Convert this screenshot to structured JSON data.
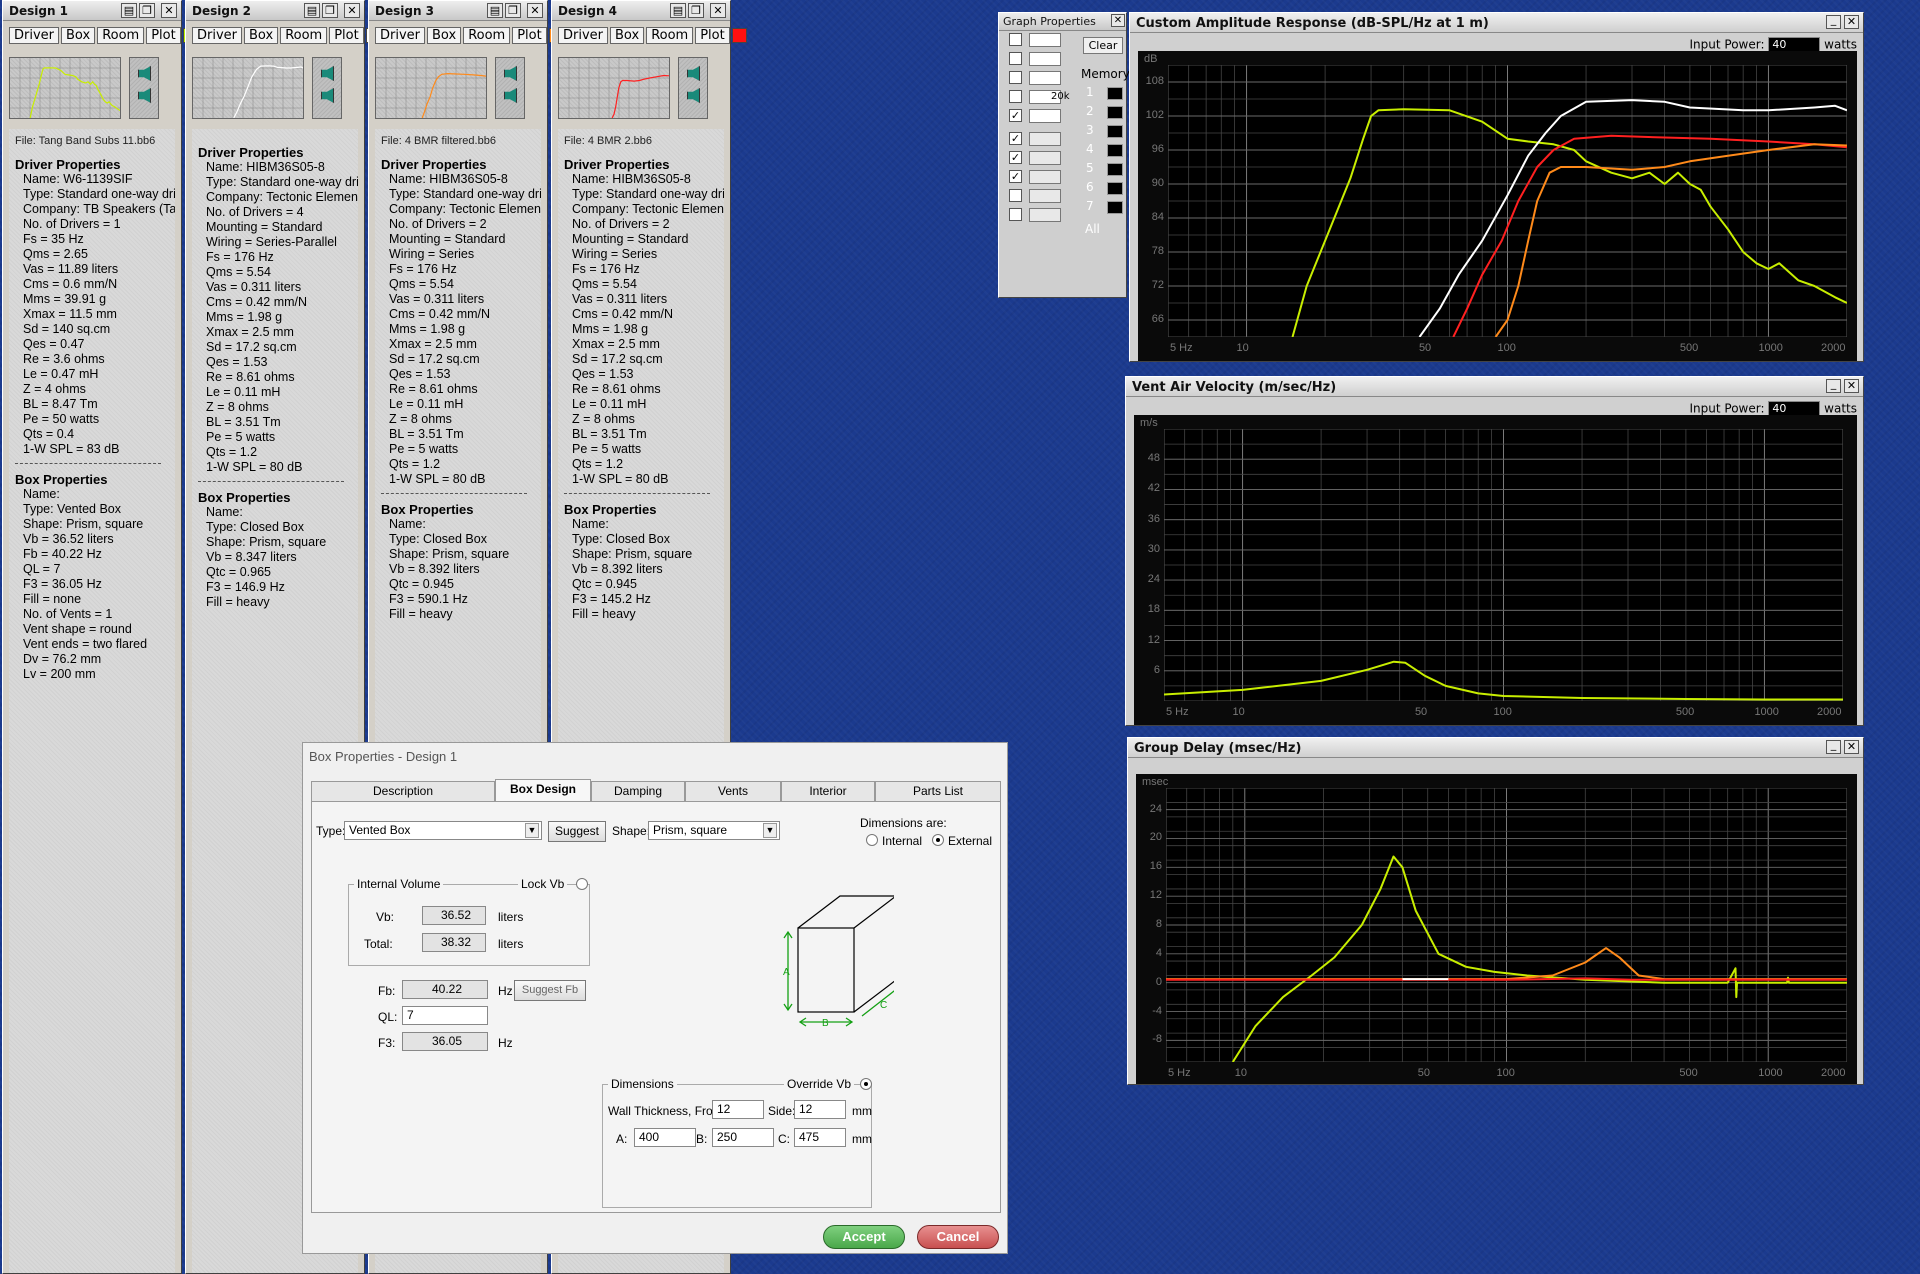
{
  "designs": [
    {
      "title": "Design 1",
      "tabs": [
        "Driver",
        "Box",
        "Room",
        "Plot"
      ],
      "swatch": "#b8f000",
      "color": "#c8ee00",
      "file": "File: Tang Band Subs 11.bb6",
      "driver_header": "Driver Properties",
      "driver": [
        "Name: W6-1139SIF",
        "Type: Standard one-way driver",
        "Company: TB Speakers  (Tang Band)",
        "No. of Drivers = 1",
        "Fs = 35 Hz",
        "Qms = 2.65",
        "Vas = 11.89 liters",
        "Cms = 0.6 mm/N",
        "Mms = 39.91 g",
        "Xmax = 11.5 mm",
        "Sd = 140 sq.cm",
        "Qes = 0.47",
        "Re = 3.6 ohms",
        "Le = 0.47 mH",
        "Z = 4 ohms",
        "BL = 8.47 Tm",
        "Pe = 50 watts",
        "Qts = 0.4",
        "1-W SPL = 83 dB"
      ],
      "box_header": "Box Properties",
      "box": [
        "Name:",
        "Type: Vented Box",
        "Shape: Prism, square",
        "Vb = 36.52 liters",
        "Fb = 40.22 Hz",
        "QL = 7",
        "F3 = 36.05 Hz",
        "Fill = none",
        "No. of Vents = 1",
        "Vent shape = round",
        "Vent ends = two flared",
        "Dv = 76.2 mm",
        "Lv = 200 mm"
      ]
    },
    {
      "title": "Design 2",
      "tabs": [
        "Driver",
        "Box",
        "Room",
        "Plot"
      ],
      "swatch": "#ffffff",
      "color": "#ffffff",
      "file": "",
      "driver_header": "Driver Properties",
      "driver": [
        "Name: HIBM36S05-8",
        "Type: Standard one-way driver",
        "Company: Tectonic Elements",
        "No. of Drivers = 4",
        "Mounting = Standard",
        "Wiring = Series-Parallel",
        "Fs = 176 Hz",
        "Qms = 5.54",
        "Vas = 0.311 liters",
        "Cms = 0.42 mm/N",
        "Mms = 1.98 g",
        "Xmax = 2.5 mm",
        "Sd = 17.2 sq.cm",
        "Qes = 1.53",
        "Re = 8.61 ohms",
        "Le = 0.11 mH",
        "Z = 8 ohms",
        "BL = 3.51 Tm",
        "Pe = 5 watts",
        "Qts = 1.2",
        "1-W SPL = 80 dB"
      ],
      "box_header": "Box Properties",
      "box": [
        "Name:",
        "Type: Closed Box",
        "Shape: Prism, square",
        "Vb = 8.347 liters",
        "Qtc = 0.965",
        "F3 = 146.9 Hz",
        "Fill = heavy"
      ]
    },
    {
      "title": "Design 3",
      "tabs": [
        "Driver",
        "Box",
        "Room",
        "Plot"
      ],
      "swatch": "#ff8a1a",
      "color": "#ff8a1a",
      "file": "File: 4 BMR filtered.bb6",
      "driver_header": "Driver Properties",
      "driver": [
        "Name: HIBM36S05-8",
        "Type: Standard one-way driver",
        "Company: Tectonic Elements",
        "No. of Drivers = 2",
        "Mounting = Standard",
        "Wiring = Series",
        "Fs = 176 Hz",
        "Qms = 5.54",
        "Vas = 0.311 liters",
        "Cms = 0.42 mm/N",
        "Mms = 1.98 g",
        "Xmax = 2.5 mm",
        "Sd = 17.2 sq.cm",
        "Qes = 1.53",
        "Re = 8.61 ohms",
        "Le = 0.11 mH",
        "Z = 8 ohms",
        "BL = 3.51 Tm",
        "Pe = 5 watts",
        "Qts = 1.2",
        "1-W SPL = 80 dB"
      ],
      "box_header": "Box Properties",
      "box": [
        "Name:",
        "Type: Closed Box",
        "Shape: Prism, square",
        "Vb = 8.392 liters",
        "Qtc = 0.945",
        "F3 = 590.1 Hz",
        "Fill = heavy"
      ]
    },
    {
      "title": "Design 4",
      "tabs": [
        "Driver",
        "Box",
        "Room",
        "Plot"
      ],
      "swatch": "#ff1010",
      "color": "#ff2020",
      "file": "File: 4 BMR 2.bb6",
      "driver_header": "Driver Properties",
      "driver": [
        "Name: HIBM36S05-8",
        "Type: Standard one-way driver",
        "Company: Tectonic Elements",
        "No. of Drivers = 2",
        "Mounting = Standard",
        "Wiring = Series",
        "Fs = 176 Hz",
        "Qms = 5.54",
        "Vas = 0.311 liters",
        "Cms = 0.42 mm/N",
        "Mms = 1.98 g",
        "Xmax = 2.5 mm",
        "Sd = 17.2 sq.cm",
        "Qes = 1.53",
        "Re = 8.61 ohms",
        "Le = 0.11 mH",
        "Z = 8 ohms",
        "BL = 3.51 Tm",
        "Pe = 5 watts",
        "Qts = 1.2",
        "1-W SPL = 80 dB"
      ],
      "box_header": "Box Properties",
      "box": [
        "Name:",
        "Type: Closed Box",
        "Shape: Prism, square",
        "Vb = 8.392 liters",
        "Qtc = 0.945",
        "F3 = 145.2 Hz",
        "Fill = heavy"
      ]
    }
  ],
  "graph_properties": {
    "title": "Graph Properties",
    "clear": "Clear",
    "memory": "Memory",
    "slots": [
      "1",
      "2",
      "3",
      "4",
      "5",
      "6",
      "7",
      "All"
    ],
    "label_20k": "20k"
  },
  "chart_data": [
    {
      "type": "line",
      "title": "Custom Amplitude Response (dB-SPL/Hz at 1 m)",
      "input_power_label": "Input Power:",
      "input_power": "40",
      "unit": "watts",
      "ylabel": "dB",
      "xscale": "log",
      "xlim": [
        5,
        2000
      ],
      "ylim": [
        63,
        111
      ],
      "xticks": [
        "5 Hz",
        "10",
        "50",
        "100",
        "500",
        "1000",
        "2000"
      ],
      "xtick_values": [
        5,
        10,
        50,
        100,
        500,
        1000,
        2000
      ],
      "yticks": [
        66,
        72,
        78,
        84,
        90,
        96,
        102,
        108
      ],
      "grid": true,
      "series": [
        {
          "color": "#c8ee00",
          "points": [
            [
              15,
              63
            ],
            [
              17,
              72
            ],
            [
              20,
              80
            ],
            [
              25,
              91
            ],
            [
              28,
              98
            ],
            [
              30,
              102
            ],
            [
              32,
              103
            ],
            [
              40,
              103.2
            ],
            [
              60,
              103
            ],
            [
              80,
              101
            ],
            [
              100,
              98
            ],
            [
              120,
              97.5
            ],
            [
              150,
              97
            ],
            [
              180,
              96
            ],
            [
              200,
              94
            ],
            [
              250,
              92
            ],
            [
              300,
              91
            ],
            [
              350,
              92
            ],
            [
              400,
              90
            ],
            [
              450,
              92
            ],
            [
              500,
              90
            ],
            [
              550,
              89
            ],
            [
              600,
              86
            ],
            [
              700,
              82
            ],
            [
              800,
              78
            ],
            [
              900,
              76
            ],
            [
              1000,
              75
            ],
            [
              1100,
              76
            ],
            [
              1300,
              73
            ],
            [
              1500,
              72
            ],
            [
              1800,
              70
            ],
            [
              2000,
              69
            ]
          ]
        },
        {
          "color": "#ffffff",
          "points": [
            [
              46,
              63
            ],
            [
              55,
              68
            ],
            [
              65,
              74
            ],
            [
              80,
              80
            ],
            [
              100,
              88
            ],
            [
              120,
              95
            ],
            [
              140,
              99
            ],
            [
              160,
              102
            ],
            [
              200,
              104.5
            ],
            [
              300,
              104.8
            ],
            [
              400,
              104.5
            ],
            [
              500,
              103.5
            ],
            [
              800,
              103
            ],
            [
              1000,
              103
            ],
            [
              1500,
              103.5
            ],
            [
              1800,
              103.8
            ],
            [
              2000,
              103
            ]
          ]
        },
        {
          "color": "#ff2020",
          "points": [
            [
              62,
              63
            ],
            [
              70,
              68
            ],
            [
              80,
              74
            ],
            [
              95,
              80
            ],
            [
              110,
              87
            ],
            [
              130,
              93
            ],
            [
              150,
              96
            ],
            [
              180,
              98
            ],
            [
              250,
              98.5
            ],
            [
              400,
              98.2
            ],
            [
              600,
              98
            ],
            [
              1000,
              97.5
            ],
            [
              1500,
              97
            ],
            [
              2000,
              96.5
            ]
          ]
        },
        {
          "color": "#ff8a1a",
          "points": [
            [
              90,
              63
            ],
            [
              100,
              66
            ],
            [
              110,
              72
            ],
            [
              120,
              80
            ],
            [
              130,
              87
            ],
            [
              145,
              92
            ],
            [
              160,
              93
            ],
            [
              200,
              93
            ],
            [
              300,
              92.5
            ],
            [
              400,
              93
            ],
            [
              500,
              94
            ],
            [
              700,
              95
            ],
            [
              1000,
              96
            ],
            [
              1500,
              97
            ],
            [
              2000,
              96.8
            ]
          ]
        }
      ]
    },
    {
      "type": "line",
      "title": "Vent Air Velocity (m/sec/Hz)",
      "input_power_label": "Input Power:",
      "input_power": "40",
      "unit": "watts",
      "ylabel": "m/s",
      "xscale": "log",
      "xlim": [
        5,
        2000
      ],
      "ylim": [
        0,
        54
      ],
      "xticks": [
        "5 Hz",
        "10",
        "50",
        "100",
        "500",
        "1000",
        "2000"
      ],
      "xtick_values": [
        5,
        10,
        50,
        100,
        500,
        1000,
        2000
      ],
      "yticks": [
        6,
        12,
        18,
        24,
        30,
        36,
        42,
        48
      ],
      "grid": true,
      "series": [
        {
          "color": "#c8ee00",
          "points": [
            [
              5,
              1.3
            ],
            [
              10,
              2.2
            ],
            [
              20,
              4
            ],
            [
              30,
              6.2
            ],
            [
              38,
              7.8
            ],
            [
              42,
              7.6
            ],
            [
              50,
              5
            ],
            [
              60,
              3
            ],
            [
              80,
              1.5
            ],
            [
              100,
              1
            ],
            [
              200,
              0.6
            ],
            [
              500,
              0.4
            ],
            [
              1000,
              0.3
            ],
            [
              2000,
              0.3
            ]
          ]
        }
      ]
    },
    {
      "type": "line",
      "title": "Group Delay (msec/Hz)",
      "ylabel": "msec",
      "xscale": "log",
      "xlim": [
        5,
        2000
      ],
      "ylim": [
        -11,
        27
      ],
      "xticks": [
        "5 Hz",
        "10",
        "50",
        "100",
        "500",
        "1000",
        "2000"
      ],
      "xtick_values": [
        5,
        10,
        50,
        100,
        500,
        1000,
        2000
      ],
      "yticks": [
        -8,
        -4,
        0,
        4,
        8,
        12,
        16,
        20,
        24
      ],
      "grid": true,
      "series": [
        {
          "color": "#c8ee00",
          "points": [
            [
              9,
              -11
            ],
            [
              11,
              -6
            ],
            [
              14,
              -2
            ],
            [
              18,
              1
            ],
            [
              22,
              3.5
            ],
            [
              28,
              8
            ],
            [
              33,
              13
            ],
            [
              37,
              17.5
            ],
            [
              40,
              16
            ],
            [
              45,
              10
            ],
            [
              55,
              4
            ],
            [
              70,
              2.2
            ],
            [
              90,
              1.5
            ],
            [
              120,
              1
            ],
            [
              200,
              0.4
            ],
            [
              400,
              0
            ],
            [
              700,
              0
            ],
            [
              750,
              2
            ],
            [
              755,
              -2
            ],
            [
              760,
              0
            ],
            [
              1000,
              0
            ],
            [
              1180,
              0
            ],
            [
              1190,
              0.7
            ],
            [
              1200,
              0
            ],
            [
              2000,
              0
            ]
          ]
        },
        {
          "color": "#ff8a1a",
          "points": [
            [
              5,
              0.5
            ],
            [
              100,
              0.5
            ],
            [
              150,
              1
            ],
            [
              200,
              2.8
            ],
            [
              240,
              4.8
            ],
            [
              270,
              3.5
            ],
            [
              320,
              1
            ],
            [
              400,
              0.5
            ],
            [
              1000,
              0.5
            ],
            [
              2000,
              0.5
            ]
          ]
        },
        {
          "color": "#ff2020",
          "points": [
            [
              5,
              0.4
            ],
            [
              100,
              0.4
            ],
            [
              200,
              0.6
            ],
            [
              300,
              0.4
            ],
            [
              2000,
              0.4
            ]
          ]
        },
        {
          "color": "#ffffff",
          "points": [
            [
              40,
              0.5
            ],
            [
              60,
              0.5
            ]
          ]
        }
      ]
    }
  ],
  "dialog": {
    "title": "Box Properties - Design 1",
    "tabs": [
      "Description",
      "Box Design",
      "Damping",
      "Vents",
      "Interior",
      "Parts List"
    ],
    "active_tab": "Box Design",
    "type_label": "Type:",
    "type_value": "Vented Box",
    "suggest": "Suggest",
    "shape_label": "Shape:",
    "shape_value": "Prism, square",
    "dims_are": "Dimensions are:",
    "internal": "Internal",
    "external": "External",
    "internal_volume": "Internal Volume",
    "lock_vb": "Lock Vb",
    "vb_label": "Vb:",
    "vb_value": "36.52",
    "total_label": "Total:",
    "total_value": "38.32",
    "liters": "liters",
    "fb_label": "Fb:",
    "fb_value": "40.22",
    "hz": "Hz",
    "suggest_fb": "Suggest Fb",
    "ql_label": "QL:",
    "ql_value": "7",
    "f3_label": "F3:",
    "f3_value": "36.05",
    "dimensions": "Dimensions",
    "override_vb": "Override Vb",
    "wall_label": "Wall Thickness, Front:",
    "wall_front": "12",
    "side_label": "Side:",
    "side_value": "12",
    "mm": "mm",
    "a_label": "A:",
    "a_value": "400",
    "b_label": "B:",
    "b_value": "250",
    "c_label": "C:",
    "c_value": "475",
    "dim_a": "A",
    "dim_b": "B",
    "dim_c": "C",
    "accept": "Accept",
    "cancel": "Cancel",
    "accept_color": "#4aa84a",
    "cancel_color": "#c85050"
  }
}
